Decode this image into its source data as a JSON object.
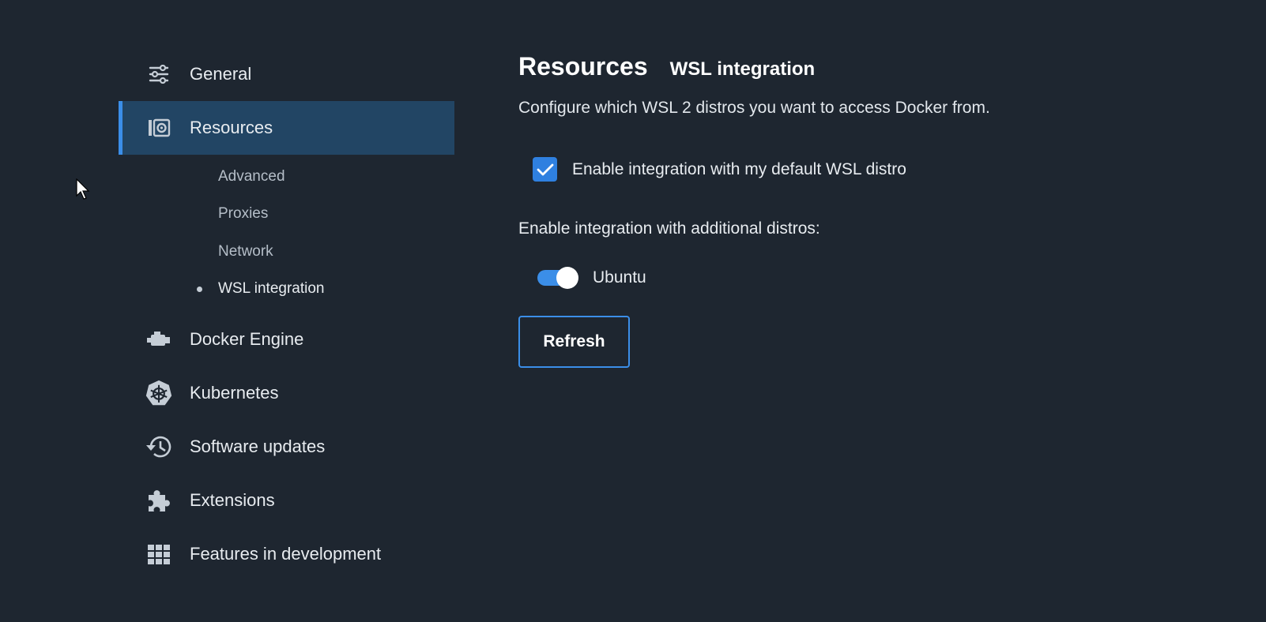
{
  "sidebar": {
    "items": [
      {
        "label": "General",
        "icon": "sliders-icon"
      },
      {
        "label": "Resources",
        "icon": "resources-icon",
        "active": true
      },
      {
        "label": "Docker Engine",
        "icon": "engine-icon"
      },
      {
        "label": "Kubernetes",
        "icon": "kubernetes-icon"
      },
      {
        "label": "Software updates",
        "icon": "history-icon"
      },
      {
        "label": "Extensions",
        "icon": "puzzle-icon"
      },
      {
        "label": "Features in development",
        "icon": "grid-icon"
      }
    ],
    "resources_sub": [
      {
        "label": "Advanced"
      },
      {
        "label": "Proxies"
      },
      {
        "label": "Network"
      },
      {
        "label": "WSL integration",
        "current": true
      }
    ]
  },
  "main": {
    "title": "Resources",
    "subtitle": "WSL integration",
    "description": "Configure which WSL 2 distros you want to access Docker from.",
    "default_distro": {
      "label": "Enable integration with my default WSL distro",
      "checked": true
    },
    "additional_label": "Enable integration with additional distros:",
    "distros": [
      {
        "name": "Ubuntu",
        "enabled": true
      }
    ],
    "refresh_label": "Refresh"
  },
  "colors": {
    "background": "#1e2630",
    "accent": "#3b8ee8",
    "active_bg": "#224564"
  }
}
